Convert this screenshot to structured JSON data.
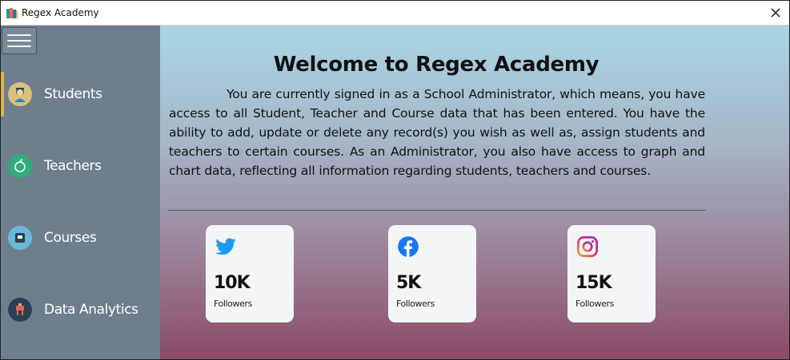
{
  "window": {
    "title": "Regex Academy",
    "app_icon": "books-icon",
    "close_glyph": "✕"
  },
  "sidebar": {
    "menu_icon": "hamburger-menu-icon",
    "items": [
      {
        "label": "Students",
        "icon": "student-icon",
        "icon_color": "#d8c37a",
        "active": true
      },
      {
        "label": "Teachers",
        "icon": "apple-icon",
        "icon_color": "#2fae78",
        "active": false
      },
      {
        "label": "Courses",
        "icon": "book-icon",
        "icon_color": "#68b8d8",
        "active": false
      },
      {
        "label": "Data Analytics",
        "icon": "chart-icon",
        "icon_color": "#2e3f55",
        "active": false
      }
    ]
  },
  "main": {
    "title": "Welcome to Regex Academy",
    "description": "You are currently signed in as a School Administrator, which means, you have access to all Student, Teacher and Course data that has been entered. You have the ability to add, update or delete any record(s) you wish as well as, assign students and teachers to certain courses. As an Administrator, you also have access to graph and chart data, reflecting all information regarding students, teachers and courses.",
    "cards": [
      {
        "count": "10K",
        "label": "Followers",
        "icon": "twitter-icon",
        "color": "#1d9bf0"
      },
      {
        "count": "5K",
        "label": "Followers",
        "icon": "facebook-icon",
        "color": "#1877f2"
      },
      {
        "count": "15K",
        "label": "Followers",
        "icon": "instagram-icon",
        "color": "#e1306c"
      }
    ]
  },
  "colors": {
    "sidebar": "#6f7e8d",
    "active_indicator": "#d9b24c",
    "gradient_top": "#a9d6e5",
    "gradient_bottom": "#8b4a66"
  }
}
